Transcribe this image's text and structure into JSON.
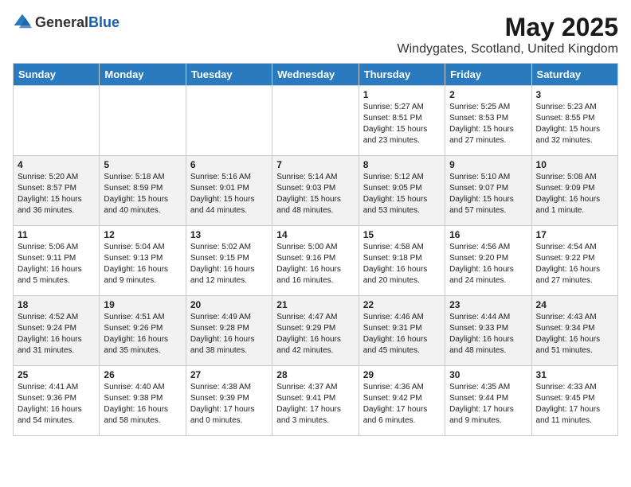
{
  "logo": {
    "general": "General",
    "blue": "Blue"
  },
  "title": "May 2025",
  "subtitle": "Windygates, Scotland, United Kingdom",
  "days_of_week": [
    "Sunday",
    "Monday",
    "Tuesday",
    "Wednesday",
    "Thursday",
    "Friday",
    "Saturday"
  ],
  "weeks": [
    [
      {
        "day": "",
        "content": ""
      },
      {
        "day": "",
        "content": ""
      },
      {
        "day": "",
        "content": ""
      },
      {
        "day": "",
        "content": ""
      },
      {
        "day": "1",
        "content": "Sunrise: 5:27 AM\nSunset: 8:51 PM\nDaylight: 15 hours\nand 23 minutes."
      },
      {
        "day": "2",
        "content": "Sunrise: 5:25 AM\nSunset: 8:53 PM\nDaylight: 15 hours\nand 27 minutes."
      },
      {
        "day": "3",
        "content": "Sunrise: 5:23 AM\nSunset: 8:55 PM\nDaylight: 15 hours\nand 32 minutes."
      }
    ],
    [
      {
        "day": "4",
        "content": "Sunrise: 5:20 AM\nSunset: 8:57 PM\nDaylight: 15 hours\nand 36 minutes."
      },
      {
        "day": "5",
        "content": "Sunrise: 5:18 AM\nSunset: 8:59 PM\nDaylight: 15 hours\nand 40 minutes."
      },
      {
        "day": "6",
        "content": "Sunrise: 5:16 AM\nSunset: 9:01 PM\nDaylight: 15 hours\nand 44 minutes."
      },
      {
        "day": "7",
        "content": "Sunrise: 5:14 AM\nSunset: 9:03 PM\nDaylight: 15 hours\nand 48 minutes."
      },
      {
        "day": "8",
        "content": "Sunrise: 5:12 AM\nSunset: 9:05 PM\nDaylight: 15 hours\nand 53 minutes."
      },
      {
        "day": "9",
        "content": "Sunrise: 5:10 AM\nSunset: 9:07 PM\nDaylight: 15 hours\nand 57 minutes."
      },
      {
        "day": "10",
        "content": "Sunrise: 5:08 AM\nSunset: 9:09 PM\nDaylight: 16 hours\nand 1 minute."
      }
    ],
    [
      {
        "day": "11",
        "content": "Sunrise: 5:06 AM\nSunset: 9:11 PM\nDaylight: 16 hours\nand 5 minutes."
      },
      {
        "day": "12",
        "content": "Sunrise: 5:04 AM\nSunset: 9:13 PM\nDaylight: 16 hours\nand 9 minutes."
      },
      {
        "day": "13",
        "content": "Sunrise: 5:02 AM\nSunset: 9:15 PM\nDaylight: 16 hours\nand 12 minutes."
      },
      {
        "day": "14",
        "content": "Sunrise: 5:00 AM\nSunset: 9:16 PM\nDaylight: 16 hours\nand 16 minutes."
      },
      {
        "day": "15",
        "content": "Sunrise: 4:58 AM\nSunset: 9:18 PM\nDaylight: 16 hours\nand 20 minutes."
      },
      {
        "day": "16",
        "content": "Sunrise: 4:56 AM\nSunset: 9:20 PM\nDaylight: 16 hours\nand 24 minutes."
      },
      {
        "day": "17",
        "content": "Sunrise: 4:54 AM\nSunset: 9:22 PM\nDaylight: 16 hours\nand 27 minutes."
      }
    ],
    [
      {
        "day": "18",
        "content": "Sunrise: 4:52 AM\nSunset: 9:24 PM\nDaylight: 16 hours\nand 31 minutes."
      },
      {
        "day": "19",
        "content": "Sunrise: 4:51 AM\nSunset: 9:26 PM\nDaylight: 16 hours\nand 35 minutes."
      },
      {
        "day": "20",
        "content": "Sunrise: 4:49 AM\nSunset: 9:28 PM\nDaylight: 16 hours\nand 38 minutes."
      },
      {
        "day": "21",
        "content": "Sunrise: 4:47 AM\nSunset: 9:29 PM\nDaylight: 16 hours\nand 42 minutes."
      },
      {
        "day": "22",
        "content": "Sunrise: 4:46 AM\nSunset: 9:31 PM\nDaylight: 16 hours\nand 45 minutes."
      },
      {
        "day": "23",
        "content": "Sunrise: 4:44 AM\nSunset: 9:33 PM\nDaylight: 16 hours\nand 48 minutes."
      },
      {
        "day": "24",
        "content": "Sunrise: 4:43 AM\nSunset: 9:34 PM\nDaylight: 16 hours\nand 51 minutes."
      }
    ],
    [
      {
        "day": "25",
        "content": "Sunrise: 4:41 AM\nSunset: 9:36 PM\nDaylight: 16 hours\nand 54 minutes."
      },
      {
        "day": "26",
        "content": "Sunrise: 4:40 AM\nSunset: 9:38 PM\nDaylight: 16 hours\nand 58 minutes."
      },
      {
        "day": "27",
        "content": "Sunrise: 4:38 AM\nSunset: 9:39 PM\nDaylight: 17 hours\nand 0 minutes."
      },
      {
        "day": "28",
        "content": "Sunrise: 4:37 AM\nSunset: 9:41 PM\nDaylight: 17 hours\nand 3 minutes."
      },
      {
        "day": "29",
        "content": "Sunrise: 4:36 AM\nSunset: 9:42 PM\nDaylight: 17 hours\nand 6 minutes."
      },
      {
        "day": "30",
        "content": "Sunrise: 4:35 AM\nSunset: 9:44 PM\nDaylight: 17 hours\nand 9 minutes."
      },
      {
        "day": "31",
        "content": "Sunrise: 4:33 AM\nSunset: 9:45 PM\nDaylight: 17 hours\nand 11 minutes."
      }
    ]
  ]
}
